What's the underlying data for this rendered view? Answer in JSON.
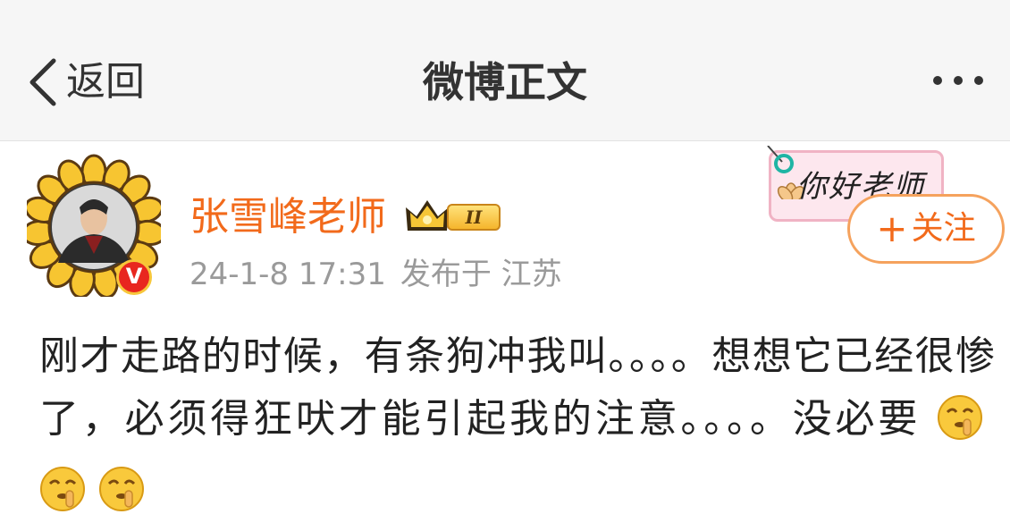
{
  "navbar": {
    "back_label": "返回",
    "title": "微博正文",
    "back_icon": "chevron-left-icon",
    "more_icon": "more-dots-icon"
  },
  "post": {
    "author": "张雪峰老师",
    "level_badge": "II",
    "verified_badge": "V",
    "time": "24-1-8 17:31",
    "location": "发布于 江苏",
    "text": "刚才走路的时候，有条狗冲我叫。。。。想想它已经很惨了，必须得狂吠才能引起我的注意。。。。没必要",
    "emojis": [
      "shush-face-emoji",
      "shush-face-emoji",
      "shush-face-emoji"
    ]
  },
  "sticker": {
    "text": "你好老师"
  },
  "follow": {
    "plus": "+",
    "label": "关注"
  },
  "colors": {
    "accent": "#f26a1b",
    "follow_border": "#f5a25d",
    "meta": "#9a9a9a",
    "nav_bg": "#f6f6f6"
  }
}
